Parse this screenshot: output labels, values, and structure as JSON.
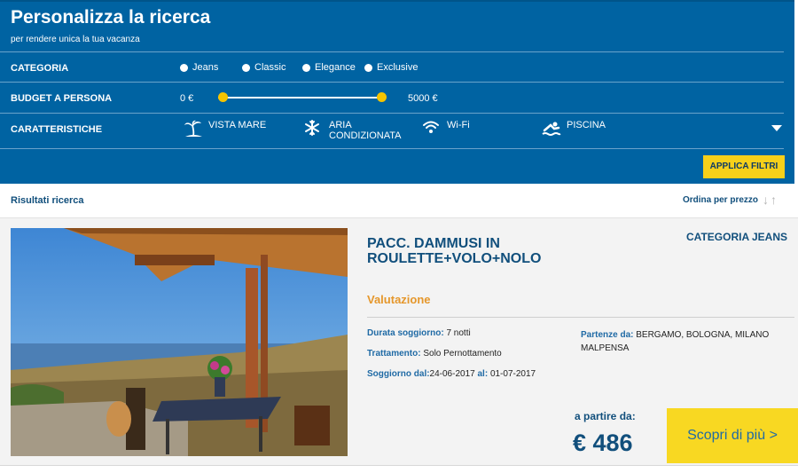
{
  "panel": {
    "title": "Personalizza la ricerca",
    "subtitle": "per rendere unica la tua vacanza",
    "category_label": "CATEGORIA",
    "categories": [
      "Jeans",
      "Classic",
      "Elegance",
      "Exclusive"
    ],
    "budget_label": "BUDGET A PERSONA",
    "budget_min": "0 €",
    "budget_max": "5000 €",
    "budget_min_fraction": 0.0,
    "budget_max_fraction": 1.0,
    "features_label": "CARATTERISTICHE",
    "features": [
      {
        "label_line1": "VISTA MARE",
        "label_line2": "",
        "icon": "beach-palm-icon"
      },
      {
        "label_line1": "ARIA",
        "label_line2": "CONDIZIONATA",
        "icon": "snowflake-icon"
      },
      {
        "label_line1": "Wi-Fi",
        "label_line2": "",
        "icon": "wifi-icon"
      },
      {
        "label_line1": "PISCINA",
        "label_line2": "",
        "icon": "swimmer-icon"
      }
    ],
    "apply_label": "APPLICA FILTRI",
    "colors": {
      "background": "#0063a2",
      "accent": "#f7d01a"
    }
  },
  "results": {
    "title": "Risultati ricerca",
    "sort_label": "Ordina per prezzo"
  },
  "card": {
    "title": "PACC. DAMMUSI IN ROULETTE+VOLO+NOLO",
    "category": "CATEGORIA JEANS",
    "rating_label": "Valutazione",
    "duration_key": "Durata soggiorno:",
    "duration_value": "7 notti",
    "treatment_key": "Trattamento:",
    "treatment_value": "Solo Pernottamento",
    "stay_key": "Soggiorno dal:",
    "stay_from": "24-06-2017",
    "stay_al_key": "al:",
    "stay_to": "01-07-2017",
    "departures_key": "Partenze da:",
    "departures_value": "BERGAMO, BOLOGNA, MILANO MALPENSA",
    "from_label": "a partire da:",
    "price": "€ 486",
    "cta_label": "Scopri di più >"
  }
}
